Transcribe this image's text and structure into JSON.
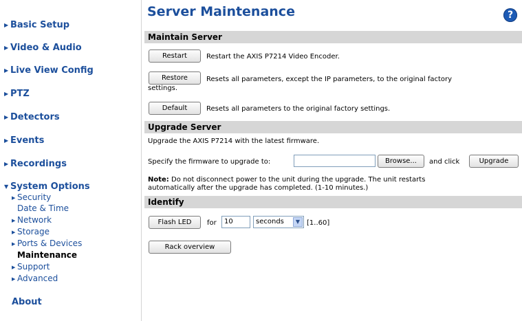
{
  "sidebar": {
    "top_items": [
      {
        "label": "Basic Setup"
      },
      {
        "label": "Video & Audio"
      },
      {
        "label": "Live View Config"
      },
      {
        "label": "PTZ"
      },
      {
        "label": "Detectors"
      },
      {
        "label": "Events"
      },
      {
        "label": "Recordings"
      },
      {
        "label": "System Options"
      }
    ],
    "system_options_children": [
      {
        "label": "Security"
      },
      {
        "label": "Date & Time"
      },
      {
        "label": "Network"
      },
      {
        "label": "Storage"
      },
      {
        "label": "Ports & Devices"
      },
      {
        "label": "Maintenance"
      },
      {
        "label": "Support"
      },
      {
        "label": "Advanced"
      }
    ],
    "about": "About"
  },
  "main": {
    "title": "Server Maintenance",
    "help_icon": "?",
    "maintain": {
      "heading": "Maintain Server",
      "restart_label": "Restart",
      "restart_desc": "Restart the AXIS P7214 Video Encoder.",
      "restore_label": "Restore",
      "restore_desc_1": "Resets all parameters, except the IP parameters, to the original factory",
      "restore_desc_2": "settings.",
      "default_label": "Default",
      "default_desc": "Resets all parameters to the original factory settings."
    },
    "upgrade": {
      "heading": "Upgrade Server",
      "intro": "Upgrade the AXIS P7214 with the latest firmware.",
      "specify_label": "Specify the firmware to upgrade to:",
      "file_value": "",
      "browse_label": "Browse...",
      "and_click": "and click",
      "upgrade_label": "Upgrade",
      "note_bold": "Note:",
      "note_text_1": " Do not disconnect power to the unit during the upgrade. The unit restarts",
      "note_text_2": "automatically after the upgrade has completed. (1-10 minutes.)"
    },
    "identify": {
      "heading": "Identify",
      "flash_label": "Flash LED",
      "for_label": "for",
      "duration_value": "10",
      "unit_value": "seconds",
      "range_label": "[1..60]",
      "rack_label": "Rack overview"
    }
  },
  "colors": {
    "nav_blue": "#1c4f9c",
    "section_grey": "#d6d6d6",
    "help_blue": "#1d5bb5"
  }
}
